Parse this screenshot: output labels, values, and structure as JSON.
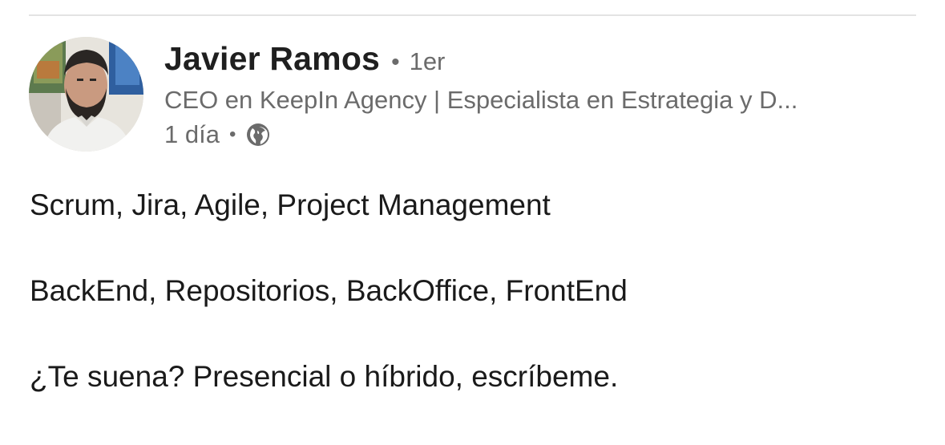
{
  "post": {
    "author": {
      "name": "Javier Ramos",
      "degree": "1er",
      "headline": "CEO en KeepIn Agency | Especialista en Estrategia y D...",
      "time": "1 día",
      "visibility_icon": "globe-icon"
    },
    "body": {
      "lines": [
        "Scrum, Jira, Agile, Project Management",
        "BackEnd, Repositorios, BackOffice, FrontEnd",
        "¿Te suena? Presencial o híbrido, escríbeme."
      ]
    }
  },
  "separator": "•",
  "colors": {
    "name": "#1f1f1f",
    "secondary_text": "#6b6b6b",
    "body_text": "#1a1a1a",
    "divider": "#e3e3e3"
  }
}
